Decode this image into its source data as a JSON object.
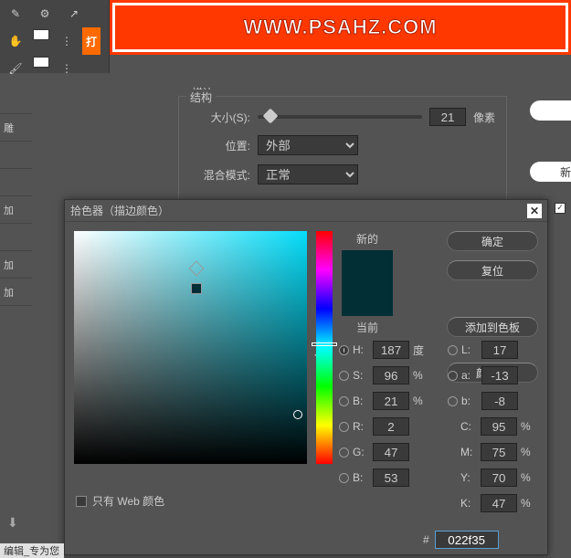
{
  "banner": {
    "text": "WWW.PSAHZ.COM"
  },
  "stroke": {
    "title": "描边",
    "structure_label": "结构",
    "size_label": "大小(S):",
    "size_value": "21",
    "size_unit": "像素",
    "position_label": "位置:",
    "position_value": "外部",
    "blend_label": "混合模式:",
    "blend_value": "正常"
  },
  "side": {
    "new_btn": "新建"
  },
  "left_items": [
    "",
    "雕",
    "",
    "",
    "加",
    "",
    "加",
    "加",
    ""
  ],
  "color_picker": {
    "title": "拾色器（描边颜色）",
    "new_label": "新的",
    "current_label": "当前",
    "ok": "确定",
    "reset": "复位",
    "add_swatch": "添加到色板",
    "color_lib": "颜色库",
    "hsv": {
      "h_label": "H:",
      "h_val": "187",
      "h_unit": "度",
      "s_label": "S:",
      "s_val": "96",
      "s_unit": "%",
      "b_label": "B:",
      "b_val": "21",
      "b_unit": "%"
    },
    "lab": {
      "l_label": "L:",
      "l_val": "17",
      "a_label": "a:",
      "a_val": "-13",
      "bb_label": "b:",
      "bb_val": "-8"
    },
    "rgb": {
      "r_label": "R:",
      "r_val": "2",
      "g_label": "G:",
      "g_val": "47",
      "b_label": "B:",
      "b_val": "53"
    },
    "cmyk": {
      "c_label": "C:",
      "c_val": "95",
      "m_label": "M:",
      "m_val": "75",
      "y_label": "Y:",
      "y_val": "70",
      "k_label": "K:",
      "k_val": "47"
    },
    "hex_label": "#",
    "hex_val": "022f35",
    "web_only": "只有 Web 颜色",
    "pct": "%",
    "swatch_new": "#022f35",
    "swatch_cur": "#022f35"
  },
  "footer": {
    "text": "编辑_专为您"
  },
  "toolbar": {
    "orange": "打"
  }
}
